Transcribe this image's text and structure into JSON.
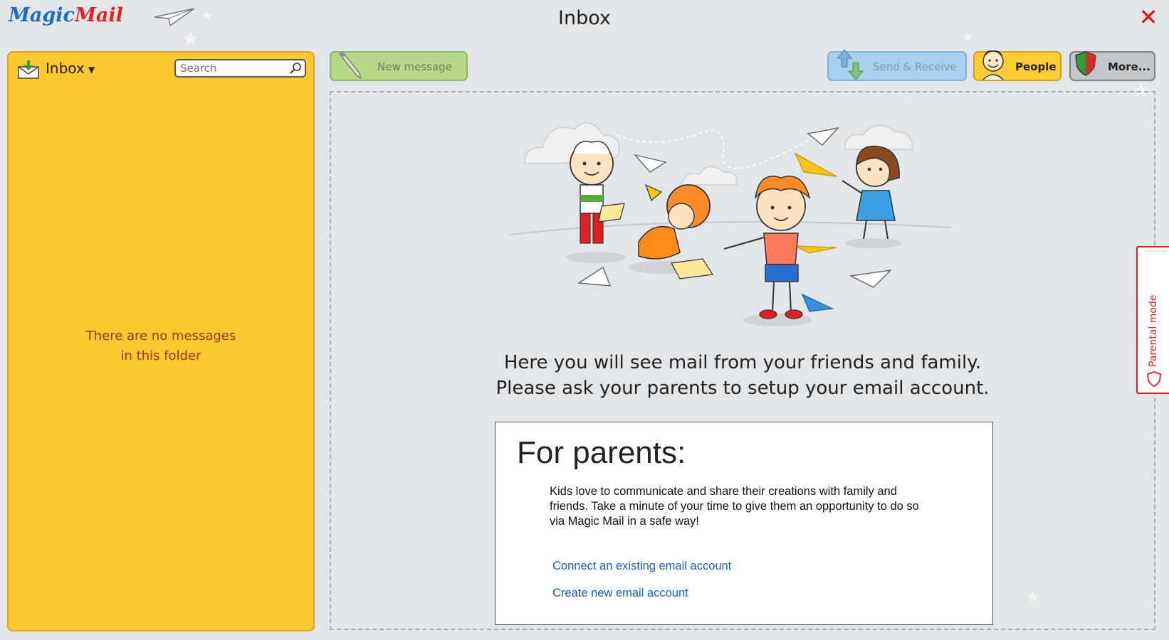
{
  "app": {
    "logo_part1": "Magic",
    "logo_part2": "Mail",
    "title": "Inbox",
    "close_icon": "close-icon"
  },
  "sidebar": {
    "folder_label": "Inbox",
    "folder_icon": "inbox-download-icon",
    "search_placeholder": "Search",
    "empty_line1": "There are no messages",
    "empty_line2": "in this folder",
    "background": "#fec92f"
  },
  "toolbar": {
    "new_message": "New message",
    "send_receive": "Send & Receive",
    "people": "People",
    "more": "More..."
  },
  "main": {
    "info_line1": "Here you will see mail from your friends and family.",
    "info_line2": "Please ask your parents to setup your email account.",
    "parents_title": "For parents:",
    "parents_desc": "Kids love to communicate and share their creations with family and friends. Take a minute of your time to give them an opportunity to do so via Magic Mail in a safe way!",
    "connect_link": "Connect an existing email account",
    "create_link": "Create new email account"
  },
  "parental_tab": {
    "label": "Parental mode",
    "icon": "shield-icon",
    "accent": "#d91e1e"
  }
}
